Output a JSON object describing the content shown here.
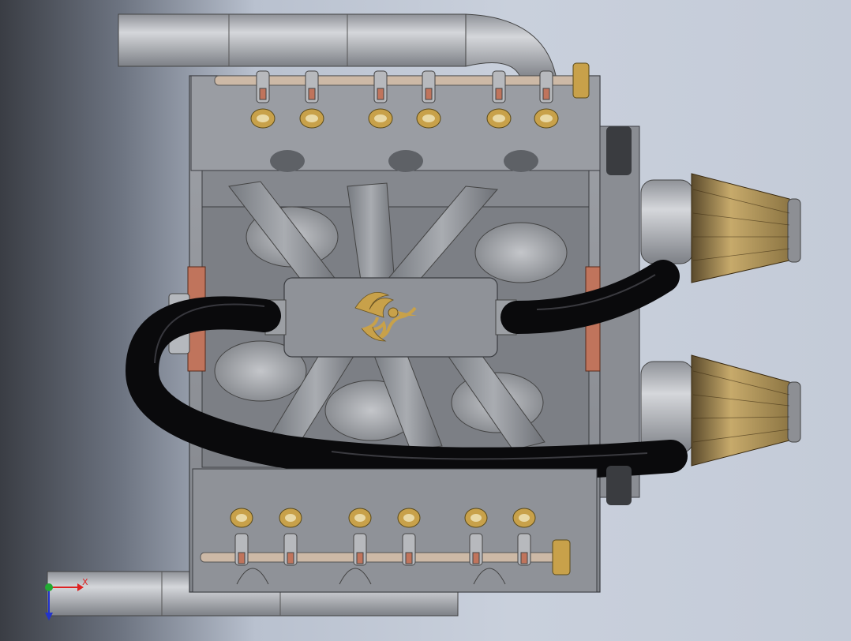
{
  "viewport": {
    "model": "engine-assembly",
    "background_top": "#c9d0dc",
    "background_left": "#3a3d44"
  },
  "colors": {
    "block": "#8d9096",
    "block_light": "#a7aab0",
    "block_dark": "#5e6166",
    "hose": "#0d0d0f",
    "filter": "#b59a63",
    "brass": "#c8a14a",
    "copper": "#c0745c",
    "exhaust": "#b4b6bb"
  },
  "emblem": {
    "icon": "phoenix-emblem-icon"
  },
  "triad": {
    "x_label": "X",
    "x_color": "#dd2222",
    "y_color": "#22aa33",
    "z_color": "#2233cc"
  }
}
